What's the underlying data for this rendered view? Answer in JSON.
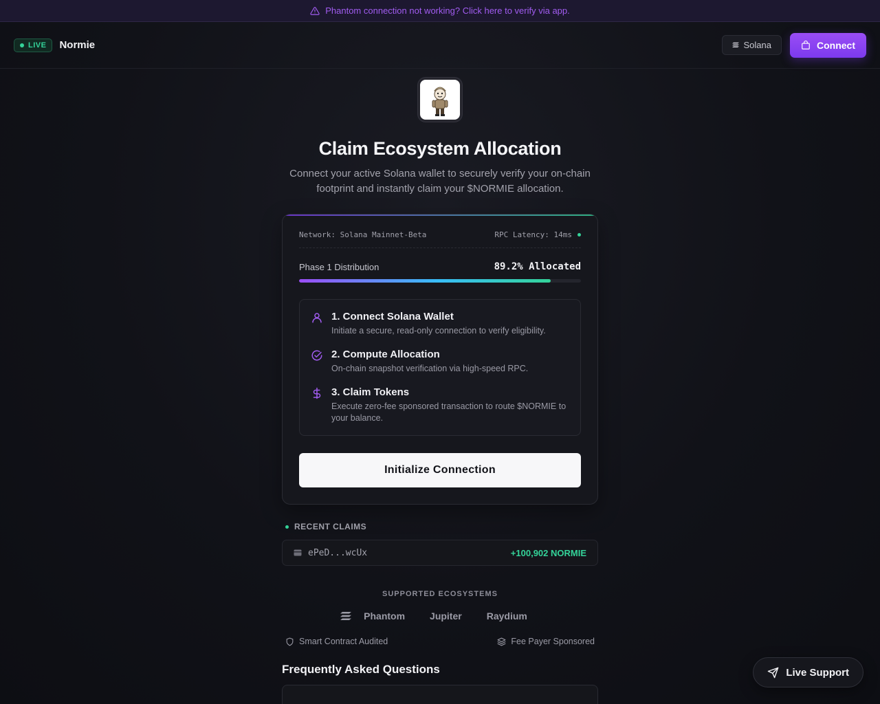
{
  "banner": {
    "text": "Phantom connection not working? Click here to verify via app.",
    "icon": "warning-icon"
  },
  "header": {
    "live_label": "LIVE",
    "brand": "Normie",
    "chain_label": "Solana",
    "connect_label": "Connect"
  },
  "hero": {
    "title": "Claim Ecosystem Allocation",
    "subtitle": "Connect your active Solana wallet to securely verify your on-chain footprint and instantly claim your $NORMIE allocation."
  },
  "card": {
    "network": "Network: Solana Mainnet-Beta",
    "latency": "RPC Latency: 14ms",
    "phase_label": "Phase 1 Distribution",
    "phase_value": "89.2% Allocated",
    "progress_percent": 89.2,
    "steps": [
      {
        "icon": "user-icon",
        "title": "1. Connect Solana Wallet",
        "desc": "Initiate a secure, read-only connection to verify eligibility."
      },
      {
        "icon": "check-circle-icon",
        "title": "2. Compute Allocation",
        "desc": "On-chain snapshot verification via high-speed RPC."
      },
      {
        "icon": "dollar-icon",
        "title": "3. Claim Tokens",
        "desc": "Execute zero-fee sponsored transaction to route $NORMIE to your balance."
      }
    ],
    "button_label": "Initialize Connection"
  },
  "recent": {
    "heading": "RECENT CLAIMS",
    "wallet": "ePeD...wcUx",
    "amount": "+100,902 NORMIE"
  },
  "ecosystems": {
    "heading": "SUPPORTED ECOSYSTEMS",
    "items": [
      "Phantom",
      "Jupiter",
      "Raydium"
    ]
  },
  "badges": {
    "audited": "Smart Contract Audited",
    "sponsored": "Fee Payer Sponsored"
  },
  "faq": {
    "title": "Frequently Asked Questions"
  },
  "support": {
    "label": "Live Support"
  },
  "colors": {
    "accent": "#9a4df5",
    "success": "#34d399",
    "background": "#111218"
  }
}
